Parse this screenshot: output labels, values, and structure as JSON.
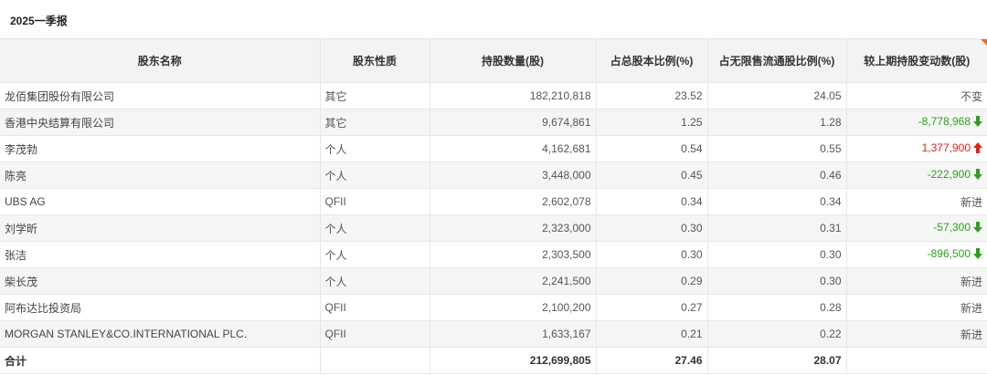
{
  "period_title": "2025一季报",
  "headers": {
    "name": "股东名称",
    "nature": "股东性质",
    "shares": "持股数量(股)",
    "total_ratio": "占总股本比例(%)",
    "float_ratio": "占无限售流通股比例(%)",
    "change": "较上期持股变动数(股)"
  },
  "rows": [
    {
      "name": "龙佰集团股份有限公司",
      "nature": "其它",
      "shares": "182,210,818",
      "total_ratio": "23.52",
      "float_ratio": "24.05",
      "change": "不变",
      "direction": "none"
    },
    {
      "name": "香港中央结算有限公司",
      "nature": "其它",
      "shares": "9,674,861",
      "total_ratio": "1.25",
      "float_ratio": "1.28",
      "change": "-8,778,968",
      "direction": "down"
    },
    {
      "name": "李茂勃",
      "nature": "个人",
      "shares": "4,162,681",
      "total_ratio": "0.54",
      "float_ratio": "0.55",
      "change": "1,377,900",
      "direction": "up"
    },
    {
      "name": "陈亮",
      "nature": "个人",
      "shares": "3,448,000",
      "total_ratio": "0.45",
      "float_ratio": "0.46",
      "change": "-222,900",
      "direction": "down"
    },
    {
      "name": "UBS AG",
      "nature": "QFII",
      "shares": "2,602,078",
      "total_ratio": "0.34",
      "float_ratio": "0.34",
      "change": "新进",
      "direction": "none"
    },
    {
      "name": "刘学昕",
      "nature": "个人",
      "shares": "2,323,000",
      "total_ratio": "0.30",
      "float_ratio": "0.31",
      "change": "-57,300",
      "direction": "down"
    },
    {
      "name": "张洁",
      "nature": "个人",
      "shares": "2,303,500",
      "total_ratio": "0.30",
      "float_ratio": "0.30",
      "change": "-896,500",
      "direction": "down"
    },
    {
      "name": "柴长茂",
      "nature": "个人",
      "shares": "2,241,500",
      "total_ratio": "0.29",
      "float_ratio": "0.30",
      "change": "新进",
      "direction": "none"
    },
    {
      "name": "阿布达比投资局",
      "nature": "QFII",
      "shares": "2,100,200",
      "total_ratio": "0.27",
      "float_ratio": "0.28",
      "change": "新进",
      "direction": "none"
    },
    {
      "name": "MORGAN STANLEY&CO.INTERNATIONAL PLC.",
      "nature": "QFII",
      "shares": "1,633,167",
      "total_ratio": "0.21",
      "float_ratio": "0.22",
      "change": "新进",
      "direction": "none"
    }
  ],
  "total": {
    "label": "合计",
    "shares": "212,699,805",
    "total_ratio": "27.46",
    "float_ratio": "28.07"
  },
  "colors": {
    "decrease": "#2f9e1f",
    "increase": "#e3231b",
    "corner_accent": "#f06a24"
  },
  "icons": {
    "down": "arrow-down-icon",
    "up": "arrow-up-icon"
  }
}
